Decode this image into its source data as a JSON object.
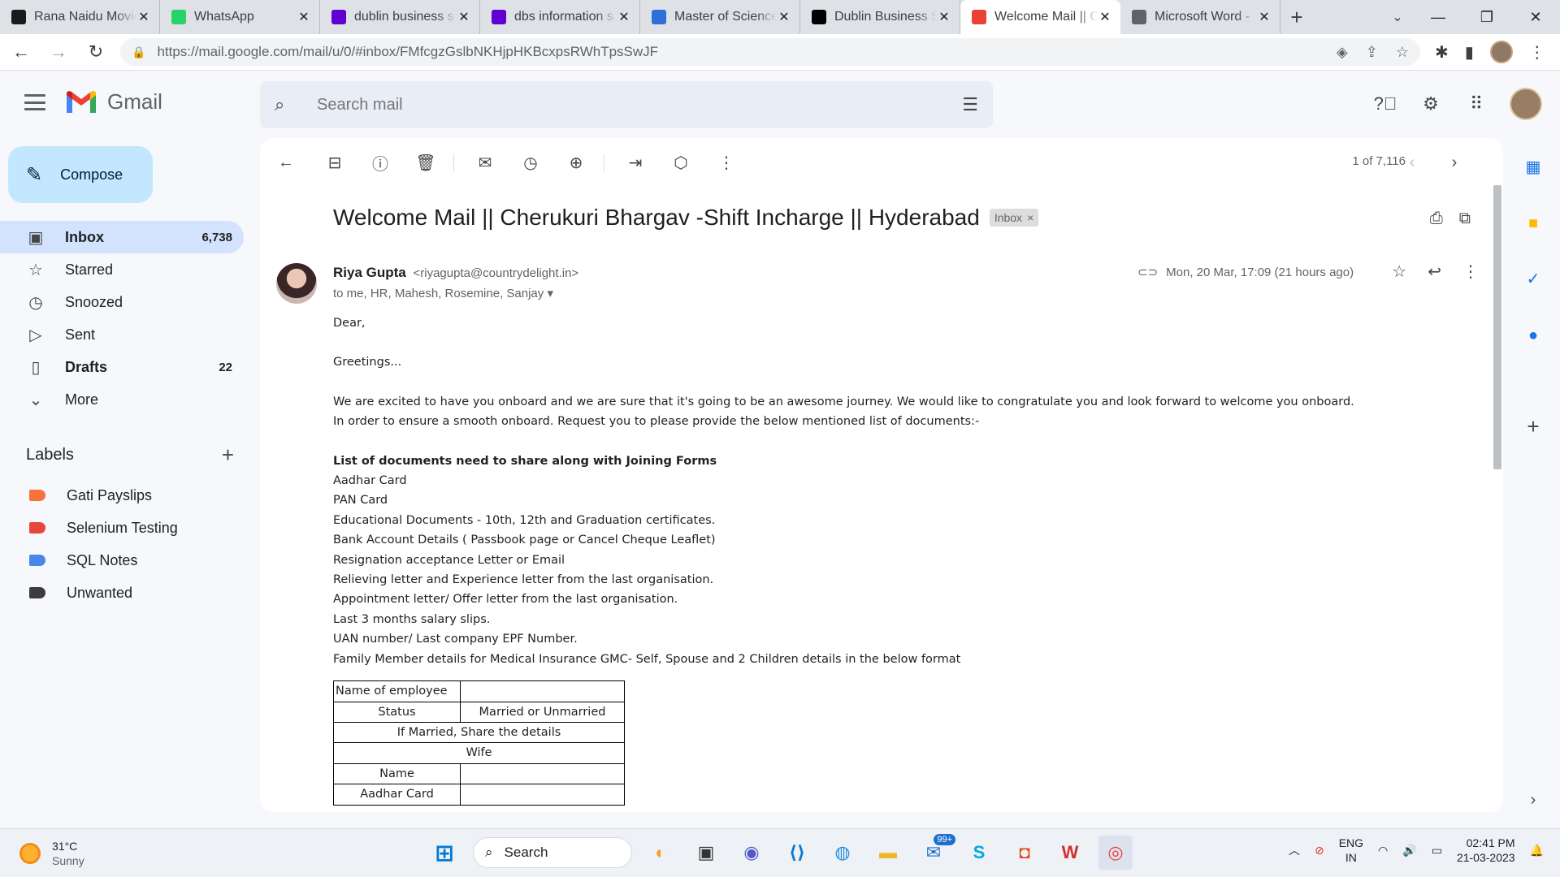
{
  "browser": {
    "tabs": [
      {
        "title": "Rana Naidu Movie",
        "favicon": "ib-icon",
        "color": "#1a1a1a"
      },
      {
        "title": "WhatsApp",
        "favicon": "whatsapp-icon",
        "color": "#25d366"
      },
      {
        "title": "dublin business s",
        "favicon": "yahoo-icon",
        "color": "#6001d2"
      },
      {
        "title": "dbs information s",
        "favicon": "yahoo-icon",
        "color": "#6001d2"
      },
      {
        "title": "Master of Science",
        "favicon": "asterisk-icon",
        "color": "#2e6fd9"
      },
      {
        "title": "Dublin Business S",
        "favicon": "wikipedia-icon",
        "color": "#000000"
      },
      {
        "title": "Welcome Mail || C",
        "favicon": "gmail-icon",
        "color": "#ea4335",
        "active": true
      },
      {
        "title": "Microsoft Word -",
        "favicon": "globe-icon",
        "color": "#5f6368"
      }
    ],
    "url": "https://mail.google.com/mail/u/0/#inbox/FMfcgzGslbNKHjpHKBcxpsRWhTpsSwJF"
  },
  "gmail": {
    "brand": "Gmail",
    "search_placeholder": "Search mail",
    "compose_label": "Compose",
    "nav": [
      {
        "label": "Inbox",
        "count": "6,738",
        "icon": "inbox-icon",
        "active": true
      },
      {
        "label": "Starred",
        "count": "",
        "icon": "star-icon"
      },
      {
        "label": "Snoozed",
        "count": "",
        "icon": "clock-icon"
      },
      {
        "label": "Sent",
        "count": "",
        "icon": "send-icon"
      },
      {
        "label": "Drafts",
        "count": "22",
        "icon": "draft-icon"
      },
      {
        "label": "More",
        "count": "",
        "icon": "chevron-down-icon"
      }
    ],
    "labels_heading": "Labels",
    "labels": [
      {
        "name": "Gati Payslips",
        "color": "#f4733c"
      },
      {
        "name": "Selenium Testing",
        "color": "#e8453c"
      },
      {
        "name": "SQL Notes",
        "color": "#4a86e8"
      },
      {
        "name": "Unwanted",
        "color": "#3c3c3c"
      }
    ]
  },
  "email": {
    "pager": "1 of 7,116",
    "subject": "Welcome Mail || Cherukuri Bhargav -Shift Incharge || Hyderabad",
    "chip": "Inbox",
    "sender_name": "Riya Gupta",
    "sender_email": "<riyagupta@countrydelight.in>",
    "recipients": "to me, HR, Mahesh, Rosemine, Sanjay",
    "date": "Mon, 20 Mar, 17:09 (21 hours ago)",
    "greeting": "Dear,",
    "greetings_line": "Greetings...",
    "para1": "We are excited to have you onboard and we are sure that it's going to be an awesome journey. We would like to congratulate you and look forward to welcome you onboard.",
    "para2": "In order to ensure a smooth onboard. Request you to please provide the below mentioned list of documents:-",
    "list_heading": "List of documents need to share along with Joining Forms",
    "documents": [
      "Aadhar Card",
      "PAN Card",
      "Educational Documents - 10th, 12th and Graduation certificates.",
      "Bank Account Details ( Passbook page or Cancel Cheque Leaflet)",
      "Resignation acceptance Letter or Email",
      "Relieving letter and Experience letter from the last organisation.",
      "Appointment letter/ Offer letter from the last organisation.",
      "Last 3 months salary slips.",
      "UAN number/ Last company EPF Number.",
      "Family Member details for Medical Insurance GMC- Self, Spouse and 2 Children details in the below format"
    ],
    "table": {
      "name_of_employee": "Name of employee",
      "status": "Status",
      "status_value": "Married or Unmarried",
      "married_note": "If Married, Share the details",
      "wife": "Wife",
      "name": "Name",
      "aadhar": "Aadhar Card"
    }
  },
  "taskbar": {
    "temperature": "31°C",
    "condition": "Sunny",
    "search": "Search",
    "mail_badge": "99+",
    "lang1": "ENG",
    "lang2": "IN",
    "time": "02:41 PM",
    "date": "21-03-2023"
  }
}
